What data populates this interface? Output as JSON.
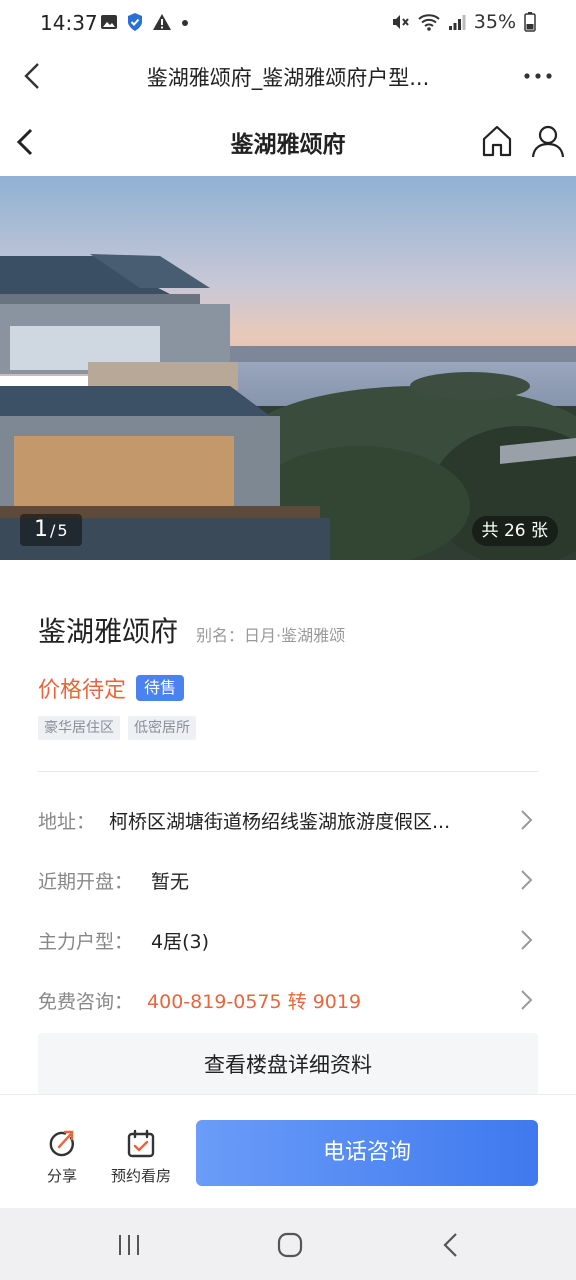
{
  "status_bar": {
    "time": "14:37",
    "battery": "35%",
    "icons": [
      "image-icon",
      "shield-icon",
      "warning-icon",
      "dot-icon",
      "mute-icon",
      "wifi-icon",
      "signal-icon",
      "battery-icon"
    ]
  },
  "browser": {
    "title": "鉴湖雅颂府_鉴湖雅颂府户型..."
  },
  "header": {
    "title": "鉴湖雅颂府"
  },
  "gallery": {
    "current": "1",
    "total": "5",
    "all_count": "共 26 张"
  },
  "project": {
    "name": "鉴湖雅颂府",
    "alias": "别名：日月·鉴湖雅颂",
    "price": "价格待定",
    "sale_status": "待售",
    "tags": [
      "豪华居住区",
      "低密居所"
    ]
  },
  "details": {
    "address_label": "地址：",
    "address_value": "柯桥区湖塘街道杨绍线鉴湖旅游度假区...",
    "opening_label": "近期开盘：",
    "opening_value": "暂无",
    "layout_label": "主力户型：",
    "layout_value": "4居(3)",
    "consult_label": "免费咨询：",
    "consult_value": "400-819-0575 转 9019"
  },
  "more_button": "查看楼盘详细资料",
  "actions": {
    "share": "分享",
    "book_visit": "预约看房",
    "call": "电话咨询"
  },
  "colors": {
    "accent_blue": "#4a82f0",
    "price_orange": "#e8663c"
  }
}
